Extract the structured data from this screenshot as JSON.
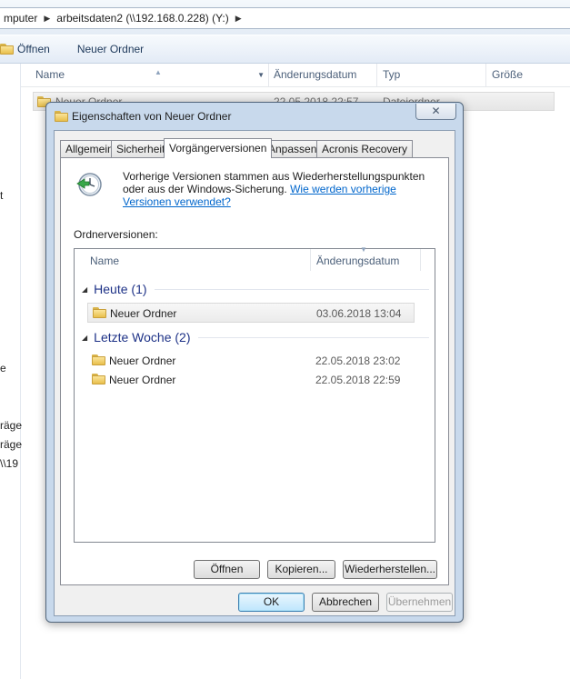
{
  "address": {
    "segments": [
      "mputer",
      "arbeitsdaten2 (\\\\192.168.0.228) (Y:)"
    ]
  },
  "toolbar": {
    "open_label": "Öffnen",
    "new_folder_label": "Neuer Ordner"
  },
  "nav_fragments": [
    "t",
    "e",
    "räge",
    "räge",
    "\\\\19"
  ],
  "columns": {
    "name": "Name",
    "date": "Änderungsdatum",
    "type": "Typ",
    "size": "Größe"
  },
  "file_row": {
    "name": "Neuer Ordner",
    "date": "22.05.2018 22:57",
    "type": "Dateiordner"
  },
  "dialog": {
    "title": "Eigenschaften von Neuer Ordner",
    "close_glyph": "✕",
    "tabs": [
      {
        "label": "Allgemein"
      },
      {
        "label": "Sicherheit"
      },
      {
        "label": "Vorgängerversionen"
      },
      {
        "label": "Anpassen"
      },
      {
        "label": "Acronis Recovery"
      }
    ],
    "info_text": "Vorherige Versionen stammen aus Wiederherstellungspunkten oder aus der Windows-Sicherung.",
    "info_link": "Wie werden vorherige Versionen verwendet?",
    "versions_label": "Ordnerversionen:",
    "list_columns": {
      "name": "Name",
      "date": "Änderungsdatum"
    },
    "groups": [
      {
        "header": "Heute (1)",
        "items": [
          {
            "name": "Neuer Ordner",
            "date": "03.06.2018 13:04"
          }
        ]
      },
      {
        "header": "Letzte Woche (2)",
        "items": [
          {
            "name": "Neuer Ordner",
            "date": "22.05.2018 23:02"
          },
          {
            "name": "Neuer Ordner",
            "date": "22.05.2018 22:59"
          }
        ]
      }
    ],
    "panel_buttons": {
      "open": "Öffnen",
      "copy": "Kopieren...",
      "restore": "Wiederherstellen..."
    },
    "footer_buttons": {
      "ok": "OK",
      "cancel": "Abbrechen",
      "apply": "Übernehmen"
    }
  }
}
